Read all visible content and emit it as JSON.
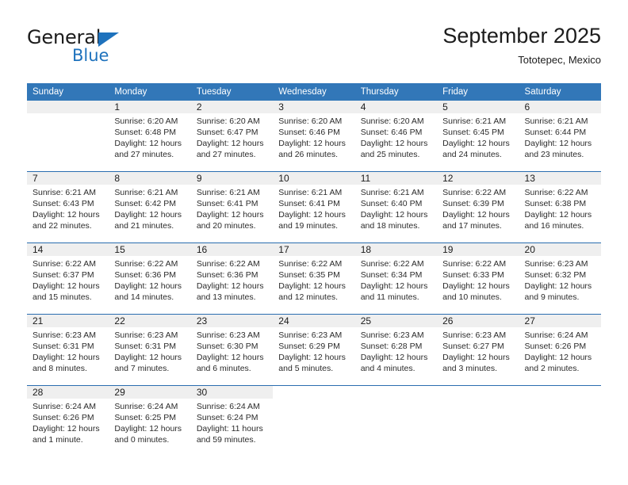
{
  "logo": {
    "primary_text": "General",
    "secondary_text": "Blue",
    "triangle_icon": "triangle-icon",
    "brand_color": "#1e72bd"
  },
  "header": {
    "title": "September 2025",
    "subtitle": "Tototepec, Mexico"
  },
  "colors": {
    "header_blue": "#3277b8",
    "row_divider_blue": "#2a6db0",
    "daynum_band": "#efefef",
    "text": "#1c1c1c"
  },
  "calendar": {
    "weekday_headers": [
      "Sunday",
      "Monday",
      "Tuesday",
      "Wednesday",
      "Thursday",
      "Friday",
      "Saturday"
    ],
    "weeks": [
      [
        {
          "day": "",
          "lines": []
        },
        {
          "day": "1",
          "lines": [
            "Sunrise: 6:20 AM",
            "Sunset: 6:48 PM",
            "Daylight: 12 hours",
            "and 27 minutes."
          ]
        },
        {
          "day": "2",
          "lines": [
            "Sunrise: 6:20 AM",
            "Sunset: 6:47 PM",
            "Daylight: 12 hours",
            "and 27 minutes."
          ]
        },
        {
          "day": "3",
          "lines": [
            "Sunrise: 6:20 AM",
            "Sunset: 6:46 PM",
            "Daylight: 12 hours",
            "and 26 minutes."
          ]
        },
        {
          "day": "4",
          "lines": [
            "Sunrise: 6:20 AM",
            "Sunset: 6:46 PM",
            "Daylight: 12 hours",
            "and 25 minutes."
          ]
        },
        {
          "day": "5",
          "lines": [
            "Sunrise: 6:21 AM",
            "Sunset: 6:45 PM",
            "Daylight: 12 hours",
            "and 24 minutes."
          ]
        },
        {
          "day": "6",
          "lines": [
            "Sunrise: 6:21 AM",
            "Sunset: 6:44 PM",
            "Daylight: 12 hours",
            "and 23 minutes."
          ]
        }
      ],
      [
        {
          "day": "7",
          "lines": [
            "Sunrise: 6:21 AM",
            "Sunset: 6:43 PM",
            "Daylight: 12 hours",
            "and 22 minutes."
          ]
        },
        {
          "day": "8",
          "lines": [
            "Sunrise: 6:21 AM",
            "Sunset: 6:42 PM",
            "Daylight: 12 hours",
            "and 21 minutes."
          ]
        },
        {
          "day": "9",
          "lines": [
            "Sunrise: 6:21 AM",
            "Sunset: 6:41 PM",
            "Daylight: 12 hours",
            "and 20 minutes."
          ]
        },
        {
          "day": "10",
          "lines": [
            "Sunrise: 6:21 AM",
            "Sunset: 6:41 PM",
            "Daylight: 12 hours",
            "and 19 minutes."
          ]
        },
        {
          "day": "11",
          "lines": [
            "Sunrise: 6:21 AM",
            "Sunset: 6:40 PM",
            "Daylight: 12 hours",
            "and 18 minutes."
          ]
        },
        {
          "day": "12",
          "lines": [
            "Sunrise: 6:22 AM",
            "Sunset: 6:39 PM",
            "Daylight: 12 hours",
            "and 17 minutes."
          ]
        },
        {
          "day": "13",
          "lines": [
            "Sunrise: 6:22 AM",
            "Sunset: 6:38 PM",
            "Daylight: 12 hours",
            "and 16 minutes."
          ]
        }
      ],
      [
        {
          "day": "14",
          "lines": [
            "Sunrise: 6:22 AM",
            "Sunset: 6:37 PM",
            "Daylight: 12 hours",
            "and 15 minutes."
          ]
        },
        {
          "day": "15",
          "lines": [
            "Sunrise: 6:22 AM",
            "Sunset: 6:36 PM",
            "Daylight: 12 hours",
            "and 14 minutes."
          ]
        },
        {
          "day": "16",
          "lines": [
            "Sunrise: 6:22 AM",
            "Sunset: 6:36 PM",
            "Daylight: 12 hours",
            "and 13 minutes."
          ]
        },
        {
          "day": "17",
          "lines": [
            "Sunrise: 6:22 AM",
            "Sunset: 6:35 PM",
            "Daylight: 12 hours",
            "and 12 minutes."
          ]
        },
        {
          "day": "18",
          "lines": [
            "Sunrise: 6:22 AM",
            "Sunset: 6:34 PM",
            "Daylight: 12 hours",
            "and 11 minutes."
          ]
        },
        {
          "day": "19",
          "lines": [
            "Sunrise: 6:22 AM",
            "Sunset: 6:33 PM",
            "Daylight: 12 hours",
            "and 10 minutes."
          ]
        },
        {
          "day": "20",
          "lines": [
            "Sunrise: 6:23 AM",
            "Sunset: 6:32 PM",
            "Daylight: 12 hours",
            "and 9 minutes."
          ]
        }
      ],
      [
        {
          "day": "21",
          "lines": [
            "Sunrise: 6:23 AM",
            "Sunset: 6:31 PM",
            "Daylight: 12 hours",
            "and 8 minutes."
          ]
        },
        {
          "day": "22",
          "lines": [
            "Sunrise: 6:23 AM",
            "Sunset: 6:31 PM",
            "Daylight: 12 hours",
            "and 7 minutes."
          ]
        },
        {
          "day": "23",
          "lines": [
            "Sunrise: 6:23 AM",
            "Sunset: 6:30 PM",
            "Daylight: 12 hours",
            "and 6 minutes."
          ]
        },
        {
          "day": "24",
          "lines": [
            "Sunrise: 6:23 AM",
            "Sunset: 6:29 PM",
            "Daylight: 12 hours",
            "and 5 minutes."
          ]
        },
        {
          "day": "25",
          "lines": [
            "Sunrise: 6:23 AM",
            "Sunset: 6:28 PM",
            "Daylight: 12 hours",
            "and 4 minutes."
          ]
        },
        {
          "day": "26",
          "lines": [
            "Sunrise: 6:23 AM",
            "Sunset: 6:27 PM",
            "Daylight: 12 hours",
            "and 3 minutes."
          ]
        },
        {
          "day": "27",
          "lines": [
            "Sunrise: 6:24 AM",
            "Sunset: 6:26 PM",
            "Daylight: 12 hours",
            "and 2 minutes."
          ]
        }
      ],
      [
        {
          "day": "28",
          "lines": [
            "Sunrise: 6:24 AM",
            "Sunset: 6:26 PM",
            "Daylight: 12 hours",
            "and 1 minute."
          ]
        },
        {
          "day": "29",
          "lines": [
            "Sunrise: 6:24 AM",
            "Sunset: 6:25 PM",
            "Daylight: 12 hours",
            "and 0 minutes."
          ]
        },
        {
          "day": "30",
          "lines": [
            "Sunrise: 6:24 AM",
            "Sunset: 6:24 PM",
            "Daylight: 11 hours",
            "and 59 minutes."
          ]
        },
        {
          "day": "",
          "lines": []
        },
        {
          "day": "",
          "lines": []
        },
        {
          "day": "",
          "lines": []
        },
        {
          "day": "",
          "lines": []
        }
      ]
    ]
  }
}
